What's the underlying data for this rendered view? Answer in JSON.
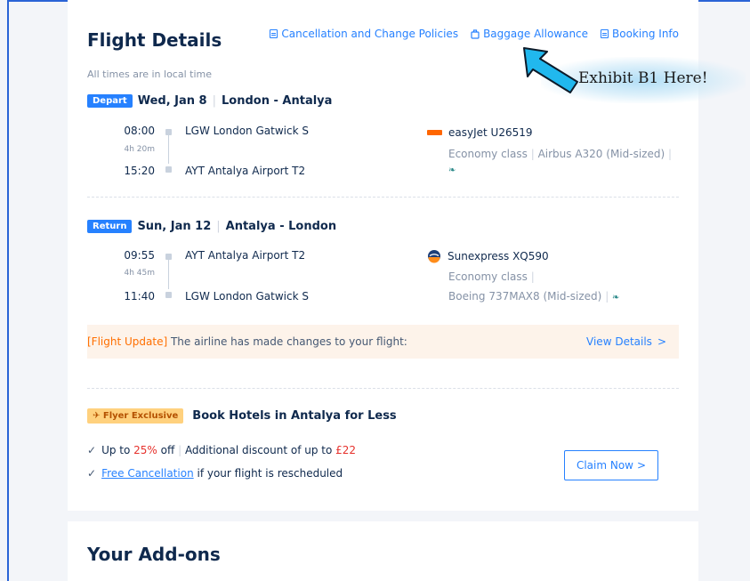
{
  "flight_details": {
    "title": "Flight Details",
    "links": [
      {
        "label": "Cancellation and Change Policies",
        "icon": "document-icon"
      },
      {
        "label": "Baggage Allowance",
        "icon": "luggage-icon"
      },
      {
        "label": "Booking Info",
        "icon": "document-icon"
      }
    ],
    "time_note": "All times are in local time",
    "depart": {
      "badge": "Depart",
      "date": "Wed, Jan 8",
      "route": "London - Antalya",
      "dep_time": "08:00",
      "duration": "4h 20m",
      "arr_time": "15:20",
      "dep_airport": "LGW  London Gatwick S",
      "arr_airport": "AYT  Antalya Airport T2",
      "airline": "easyJet U26519",
      "cabin": "Economy class",
      "aircraft": "Airbus A320 (Mid-sized)"
    },
    "return": {
      "badge": "Return",
      "date": "Sun, Jan 12",
      "route": "Antalya - London",
      "dep_time": "09:55",
      "duration": "4h 45m",
      "arr_time": "11:40",
      "dep_airport": "AYT  Antalya Airport T2",
      "arr_airport": "LGW  London Gatwick S",
      "airline": "Sunexpress XQ590",
      "cabin": "Economy class",
      "aircraft": "Boeing 737MAX8 (Mid-sized)"
    },
    "update": {
      "tag": "[Flight Update]",
      "text": " The airline has made changes to your flight:",
      "link": "View Details",
      "chevron": ">"
    },
    "promo": {
      "badge": "Flyer Exclusive",
      "title": "Book Hotels in Antalya for Less",
      "line1_prefix": "Up to ",
      "line1_pct": "25%",
      "line1_mid": " off",
      "line1_extra": "Additional discount of up to ",
      "line1_amount": "£22",
      "line2_link": "Free Cancellation",
      "line2_rest": " if your flight is rescheduled",
      "button": "Claim Now",
      "button_chevron": ">"
    }
  },
  "addons": {
    "title": "Your Add-ons"
  },
  "annotation": {
    "text": "Exhibit B1 Here!"
  },
  "colors": {
    "accent": "#2681ff",
    "text": "#0f294d",
    "muted": "#8592a6",
    "alert_orange": "#ff6f00",
    "price_red": "#e6312c",
    "arrow_cyan": "#21b8ee"
  }
}
